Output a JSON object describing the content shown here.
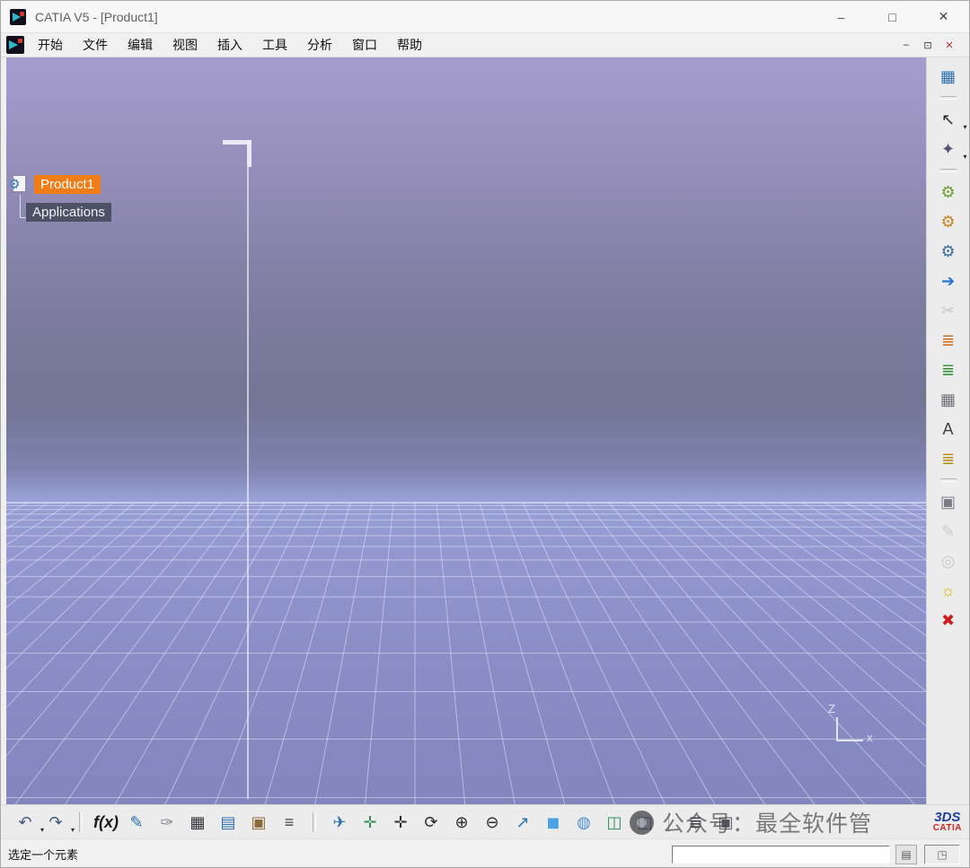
{
  "window": {
    "title": "CATIA V5 - [Product1]",
    "controls": {
      "minimize": "–",
      "maximize": "□",
      "close": "✕"
    }
  },
  "menu_bar": {
    "items": [
      {
        "id": "start",
        "label": "开始"
      },
      {
        "id": "file",
        "label": "文件"
      },
      {
        "id": "edit",
        "label": "编辑"
      },
      {
        "id": "view",
        "label": "视图"
      },
      {
        "id": "insert",
        "label": "插入"
      },
      {
        "id": "tools",
        "label": "工具"
      },
      {
        "id": "analyze",
        "label": "分析"
      },
      {
        "id": "window",
        "label": "窗口"
      },
      {
        "id": "help",
        "label": "帮助"
      }
    ],
    "doc_controls": {
      "minimize": "–",
      "restore": "⊡",
      "close": "✕"
    }
  },
  "tree": {
    "root_label": "Product1",
    "child_label": "Applications",
    "node_icon_glyph": "⚙"
  },
  "axis": {
    "up": "Z",
    "right": "x"
  },
  "right_toolbar": [
    {
      "name": "product-structure-icon",
      "glyph": "▦",
      "color": "#2f6fb5"
    },
    {
      "sep": true
    },
    {
      "name": "select-arrow-icon",
      "glyph": "↖",
      "color": "#2b2b2b",
      "dropdown": true
    },
    {
      "name": "selection-filter-icon",
      "glyph": "✦",
      "color": "#555577",
      "dropdown": true
    },
    {
      "sep": true
    },
    {
      "name": "update-gears-icon",
      "glyph": "⚙",
      "color": "#6f9f2f"
    },
    {
      "name": "catalog-gear-icon",
      "glyph": "⚙",
      "color": "#c8821e"
    },
    {
      "name": "generate-gear-icon",
      "glyph": "⚙",
      "color": "#3a6ea5"
    },
    {
      "name": "enter-component-icon",
      "glyph": "➔",
      "color": "#1f6fd0"
    },
    {
      "name": "break-link-icon",
      "glyph": "✂",
      "color": "#9a9aa0",
      "disabled": true
    },
    {
      "name": "bom-list-icon",
      "glyph": "≣",
      "color": "#cf6a1a"
    },
    {
      "name": "structure-list-icon",
      "glyph": "≣",
      "color": "#2f8f2f"
    },
    {
      "name": "design-table-icon",
      "glyph": "▦",
      "color": "#70707a"
    },
    {
      "name": "text-template-icon",
      "glyph": "A",
      "color": "#444444"
    },
    {
      "name": "tree-catalog-icon",
      "glyph": "≣",
      "color": "#b8860b"
    },
    {
      "sep": true
    },
    {
      "name": "image-frame-icon",
      "glyph": "▣",
      "color": "#7a7a8a"
    },
    {
      "name": "sketch-tracer-icon",
      "glyph": "✎",
      "color": "#a0a0a8",
      "disabled": true
    },
    {
      "name": "photo-studio-icon",
      "glyph": "◎",
      "color": "#a0a0a8",
      "disabled": true
    },
    {
      "name": "light-bulb-on-icon",
      "glyph": "☼",
      "color": "#dfb400"
    },
    {
      "name": "light-bulb-off-icon",
      "glyph": "✖",
      "color": "#cc2020"
    }
  ],
  "bottom_toolbar": [
    {
      "name": "undo-icon",
      "glyph": "↶",
      "color": "#44597e",
      "dropdown": true
    },
    {
      "name": "redo-icon",
      "glyph": "↷",
      "color": "#44597e",
      "dropdown": true
    },
    {
      "sep": true
    },
    {
      "name": "formula-icon",
      "glyph": "f(x)",
      "color": "#1a1a1a",
      "text": true
    },
    {
      "name": "comment-bubble-icon",
      "glyph": "✎",
      "color": "#2f6fb0"
    },
    {
      "name": "check-pen-icon",
      "glyph": "✑",
      "color": "#8a8a92"
    },
    {
      "name": "design-table-icon",
      "glyph": "▦",
      "color": "#33333b"
    },
    {
      "name": "product-tree-icon",
      "glyph": "▤",
      "color": "#2f6fb5"
    },
    {
      "name": "component-box-icon",
      "glyph": "▣",
      "color": "#8a6a3a"
    },
    {
      "name": "equivalent-dimensions-icon",
      "glyph": "≡",
      "color": "#44444c"
    },
    {
      "sep": true
    },
    {
      "name": "fly-mode-icon",
      "glyph": "✈",
      "color": "#2f6fb0"
    },
    {
      "name": "fit-all-icon",
      "glyph": "✛",
      "color": "#2f8f4f"
    },
    {
      "name": "pan-icon",
      "glyph": "✛",
      "color": "#2b2b2b"
    },
    {
      "name": "rotate-icon",
      "glyph": "⟳",
      "color": "#2b2b2b"
    },
    {
      "name": "zoom-in-icon",
      "glyph": "⊕",
      "color": "#2b2b2b"
    },
    {
      "name": "zoom-out-icon",
      "glyph": "⊖",
      "color": "#2b2b2b"
    },
    {
      "name": "normal-view-icon",
      "glyph": "↗",
      "color": "#2f6fb0"
    },
    {
      "name": "iso-view-icon",
      "glyph": "◼",
      "color": "#4aa3e0"
    },
    {
      "name": "multi-view-icon",
      "glyph": "◍",
      "color": "#4a8fd0"
    },
    {
      "name": "capture-icon",
      "glyph": "◫",
      "color": "#2f8f5f"
    },
    {
      "name": "album-icon",
      "glyph": "◫",
      "color": "#2f6fb5"
    },
    {
      "sep": true
    },
    {
      "name": "levels-icon",
      "glyph": "≣",
      "color": "#33333b"
    },
    {
      "name": "render-tools-icon",
      "glyph": "▣",
      "color": "#55555f"
    }
  ],
  "dropdown_glyph": "▾",
  "status_bar": {
    "message": "选定一个元素",
    "input_value": "",
    "button_icon": "▤",
    "corner_icon": "◳"
  },
  "watermark": {
    "text": "公众号：最全软件管"
  },
  "brand": {
    "mark": "3DS",
    "name": "CATIA"
  },
  "colors": {
    "selection_orange": "#f07d17",
    "tree_node_bg": "#4d5166",
    "close_button_red": "#b33636",
    "viewport_top": "#a59ecd",
    "viewport_mid": "#737595",
    "viewport_floor": "#8b90c8",
    "grid_line": "#e2e6fa"
  }
}
